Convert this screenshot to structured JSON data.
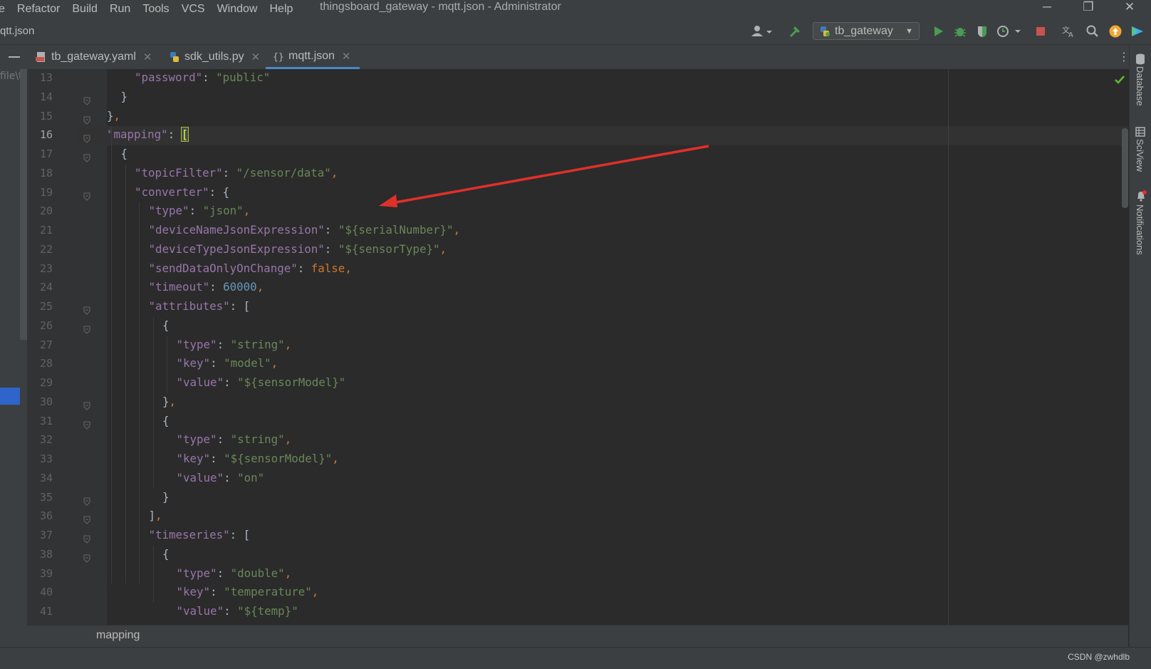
{
  "menu": {
    "items": [
      "e",
      "Refactor",
      "Build",
      "Run",
      "Tools",
      "VCS",
      "Window",
      "Help"
    ],
    "window_title": "thingsboard_gateway - mqtt.json - Administrator"
  },
  "window_controls": {
    "minimize": "─",
    "restore": "❐",
    "close": "✕"
  },
  "toolbar": {
    "breadcrumb": "qtt.json",
    "run_config": "tb_gateway",
    "icons": [
      "user-icon",
      "build-hammer-icon",
      "run-icon",
      "debug-icon",
      "coverage-icon",
      "profile-icon",
      "stop-icon",
      "translate-icon",
      "search-icon",
      "update-icon",
      "plugin-icon"
    ]
  },
  "tabs": [
    {
      "label": "tb_gateway.yaml",
      "icon": "yaml-file-icon",
      "active": false
    },
    {
      "label": "sdk_utils.py",
      "icon": "python-file-icon",
      "active": false
    },
    {
      "label": "mqtt.json",
      "icon": "json-file-icon",
      "active": true
    }
  ],
  "project_panel": {
    "path_text": "file\\tl"
  },
  "right_sidebar": {
    "labels": [
      "Database",
      "SciView",
      "Notifications"
    ]
  },
  "editor": {
    "current_line": 16,
    "lines": [
      {
        "n": "13",
        "indent": 2,
        "code": [
          [
            "k",
            "\"password\""
          ],
          [
            "t",
            ": "
          ],
          [
            "s",
            "\"public\""
          ]
        ]
      },
      {
        "n": "14",
        "indent": 1,
        "code": [
          [
            "t",
            "}"
          ]
        ]
      },
      {
        "n": "15",
        "indent": 0,
        "code": [
          [
            "t",
            "}"
          ],
          [
            "p",
            ","
          ]
        ]
      },
      {
        "n": "16",
        "indent": 0,
        "code": [
          [
            "k",
            "\"mapping\""
          ],
          [
            "t",
            ": "
          ],
          [
            "caret",
            "["
          ]
        ]
      },
      {
        "n": "17",
        "indent": 1,
        "code": [
          [
            "t",
            "{"
          ]
        ]
      },
      {
        "n": "18",
        "indent": 2,
        "code": [
          [
            "k",
            "\"topicFilter\""
          ],
          [
            "t",
            ": "
          ],
          [
            "s",
            "\"/sensor/data\""
          ],
          [
            "p",
            ","
          ]
        ]
      },
      {
        "n": "19",
        "indent": 2,
        "code": [
          [
            "k",
            "\"converter\""
          ],
          [
            "t",
            ": {"
          ]
        ]
      },
      {
        "n": "20",
        "indent": 3,
        "code": [
          [
            "k",
            "\"type\""
          ],
          [
            "t",
            ": "
          ],
          [
            "s",
            "\"json\""
          ],
          [
            "p",
            ","
          ]
        ]
      },
      {
        "n": "21",
        "indent": 3,
        "code": [
          [
            "k",
            "\"deviceNameJsonExpression\""
          ],
          [
            "t",
            ": "
          ],
          [
            "s",
            "\"${serialNumber}\""
          ],
          [
            "p",
            ","
          ]
        ]
      },
      {
        "n": "22",
        "indent": 3,
        "code": [
          [
            "k",
            "\"deviceTypeJsonExpression\""
          ],
          [
            "t",
            ": "
          ],
          [
            "s",
            "\"${sensorType}\""
          ],
          [
            "p",
            ","
          ]
        ]
      },
      {
        "n": "23",
        "indent": 3,
        "code": [
          [
            "k",
            "\"sendDataOnlyOnChange\""
          ],
          [
            "t",
            ": "
          ],
          [
            "b",
            "false"
          ],
          [
            "p",
            ","
          ]
        ]
      },
      {
        "n": "24",
        "indent": 3,
        "code": [
          [
            "k",
            "\"timeout\""
          ],
          [
            "t",
            ": "
          ],
          [
            "n",
            "60000"
          ],
          [
            "p",
            ","
          ]
        ]
      },
      {
        "n": "25",
        "indent": 3,
        "code": [
          [
            "k",
            "\"attributes\""
          ],
          [
            "t",
            ": ["
          ]
        ]
      },
      {
        "n": "26",
        "indent": 4,
        "code": [
          [
            "t",
            "{"
          ]
        ]
      },
      {
        "n": "27",
        "indent": 5,
        "code": [
          [
            "k",
            "\"type\""
          ],
          [
            "t",
            ": "
          ],
          [
            "s",
            "\"string\""
          ],
          [
            "p",
            ","
          ]
        ]
      },
      {
        "n": "28",
        "indent": 5,
        "code": [
          [
            "k",
            "\"key\""
          ],
          [
            "t",
            ": "
          ],
          [
            "s",
            "\"model\""
          ],
          [
            "p",
            ","
          ]
        ]
      },
      {
        "n": "29",
        "indent": 5,
        "code": [
          [
            "k",
            "\"value\""
          ],
          [
            "t",
            ": "
          ],
          [
            "s",
            "\"${sensorModel}\""
          ]
        ]
      },
      {
        "n": "30",
        "indent": 4,
        "code": [
          [
            "t",
            "}"
          ],
          [
            "p",
            ","
          ]
        ]
      },
      {
        "n": "31",
        "indent": 4,
        "code": [
          [
            "t",
            "{"
          ]
        ]
      },
      {
        "n": "32",
        "indent": 5,
        "code": [
          [
            "k",
            "\"type\""
          ],
          [
            "t",
            ": "
          ],
          [
            "s",
            "\"string\""
          ],
          [
            "p",
            ","
          ]
        ]
      },
      {
        "n": "33",
        "indent": 5,
        "code": [
          [
            "k",
            "\"key\""
          ],
          [
            "t",
            ": "
          ],
          [
            "s",
            "\"${sensorModel}\""
          ],
          [
            "p",
            ","
          ]
        ]
      },
      {
        "n": "34",
        "indent": 5,
        "code": [
          [
            "k",
            "\"value\""
          ],
          [
            "t",
            ": "
          ],
          [
            "s",
            "\"on\""
          ]
        ]
      },
      {
        "n": "35",
        "indent": 4,
        "code": [
          [
            "t",
            "}"
          ]
        ]
      },
      {
        "n": "36",
        "indent": 3,
        "code": [
          [
            "t",
            "]"
          ],
          [
            "p",
            ","
          ]
        ]
      },
      {
        "n": "37",
        "indent": 3,
        "code": [
          [
            "k",
            "\"timeseries\""
          ],
          [
            "t",
            ": ["
          ]
        ]
      },
      {
        "n": "38",
        "indent": 4,
        "code": [
          [
            "t",
            "{"
          ]
        ]
      },
      {
        "n": "39",
        "indent": 5,
        "code": [
          [
            "k",
            "\"type\""
          ],
          [
            "t",
            ": "
          ],
          [
            "s",
            "\"double\""
          ],
          [
            "p",
            ","
          ]
        ]
      },
      {
        "n": "40",
        "indent": 5,
        "code": [
          [
            "k",
            "\"key\""
          ],
          [
            "t",
            ": "
          ],
          [
            "s",
            "\"temperature\""
          ],
          [
            "p",
            ","
          ]
        ]
      },
      {
        "n": "41",
        "indent": 5,
        "code": [
          [
            "k",
            "\"value\""
          ],
          [
            "t",
            ": "
          ],
          [
            "s",
            "\"${temp}\""
          ]
        ]
      }
    ],
    "folded_lines": [
      "14",
      "15",
      "16",
      "17",
      "19",
      "25",
      "26",
      "30",
      "31",
      "35",
      "36",
      "37",
      "38"
    ]
  },
  "bottom_breadcrumb": "mapping",
  "status_bar": {
    "watermark": "CSDN @zwhdlb"
  },
  "colors": {
    "accent_tab": "#4a88c7",
    "annotation_arrow": "#e0302a",
    "check": "#5fb832",
    "run_green": "#499c54",
    "stop_red": "#c75450"
  }
}
